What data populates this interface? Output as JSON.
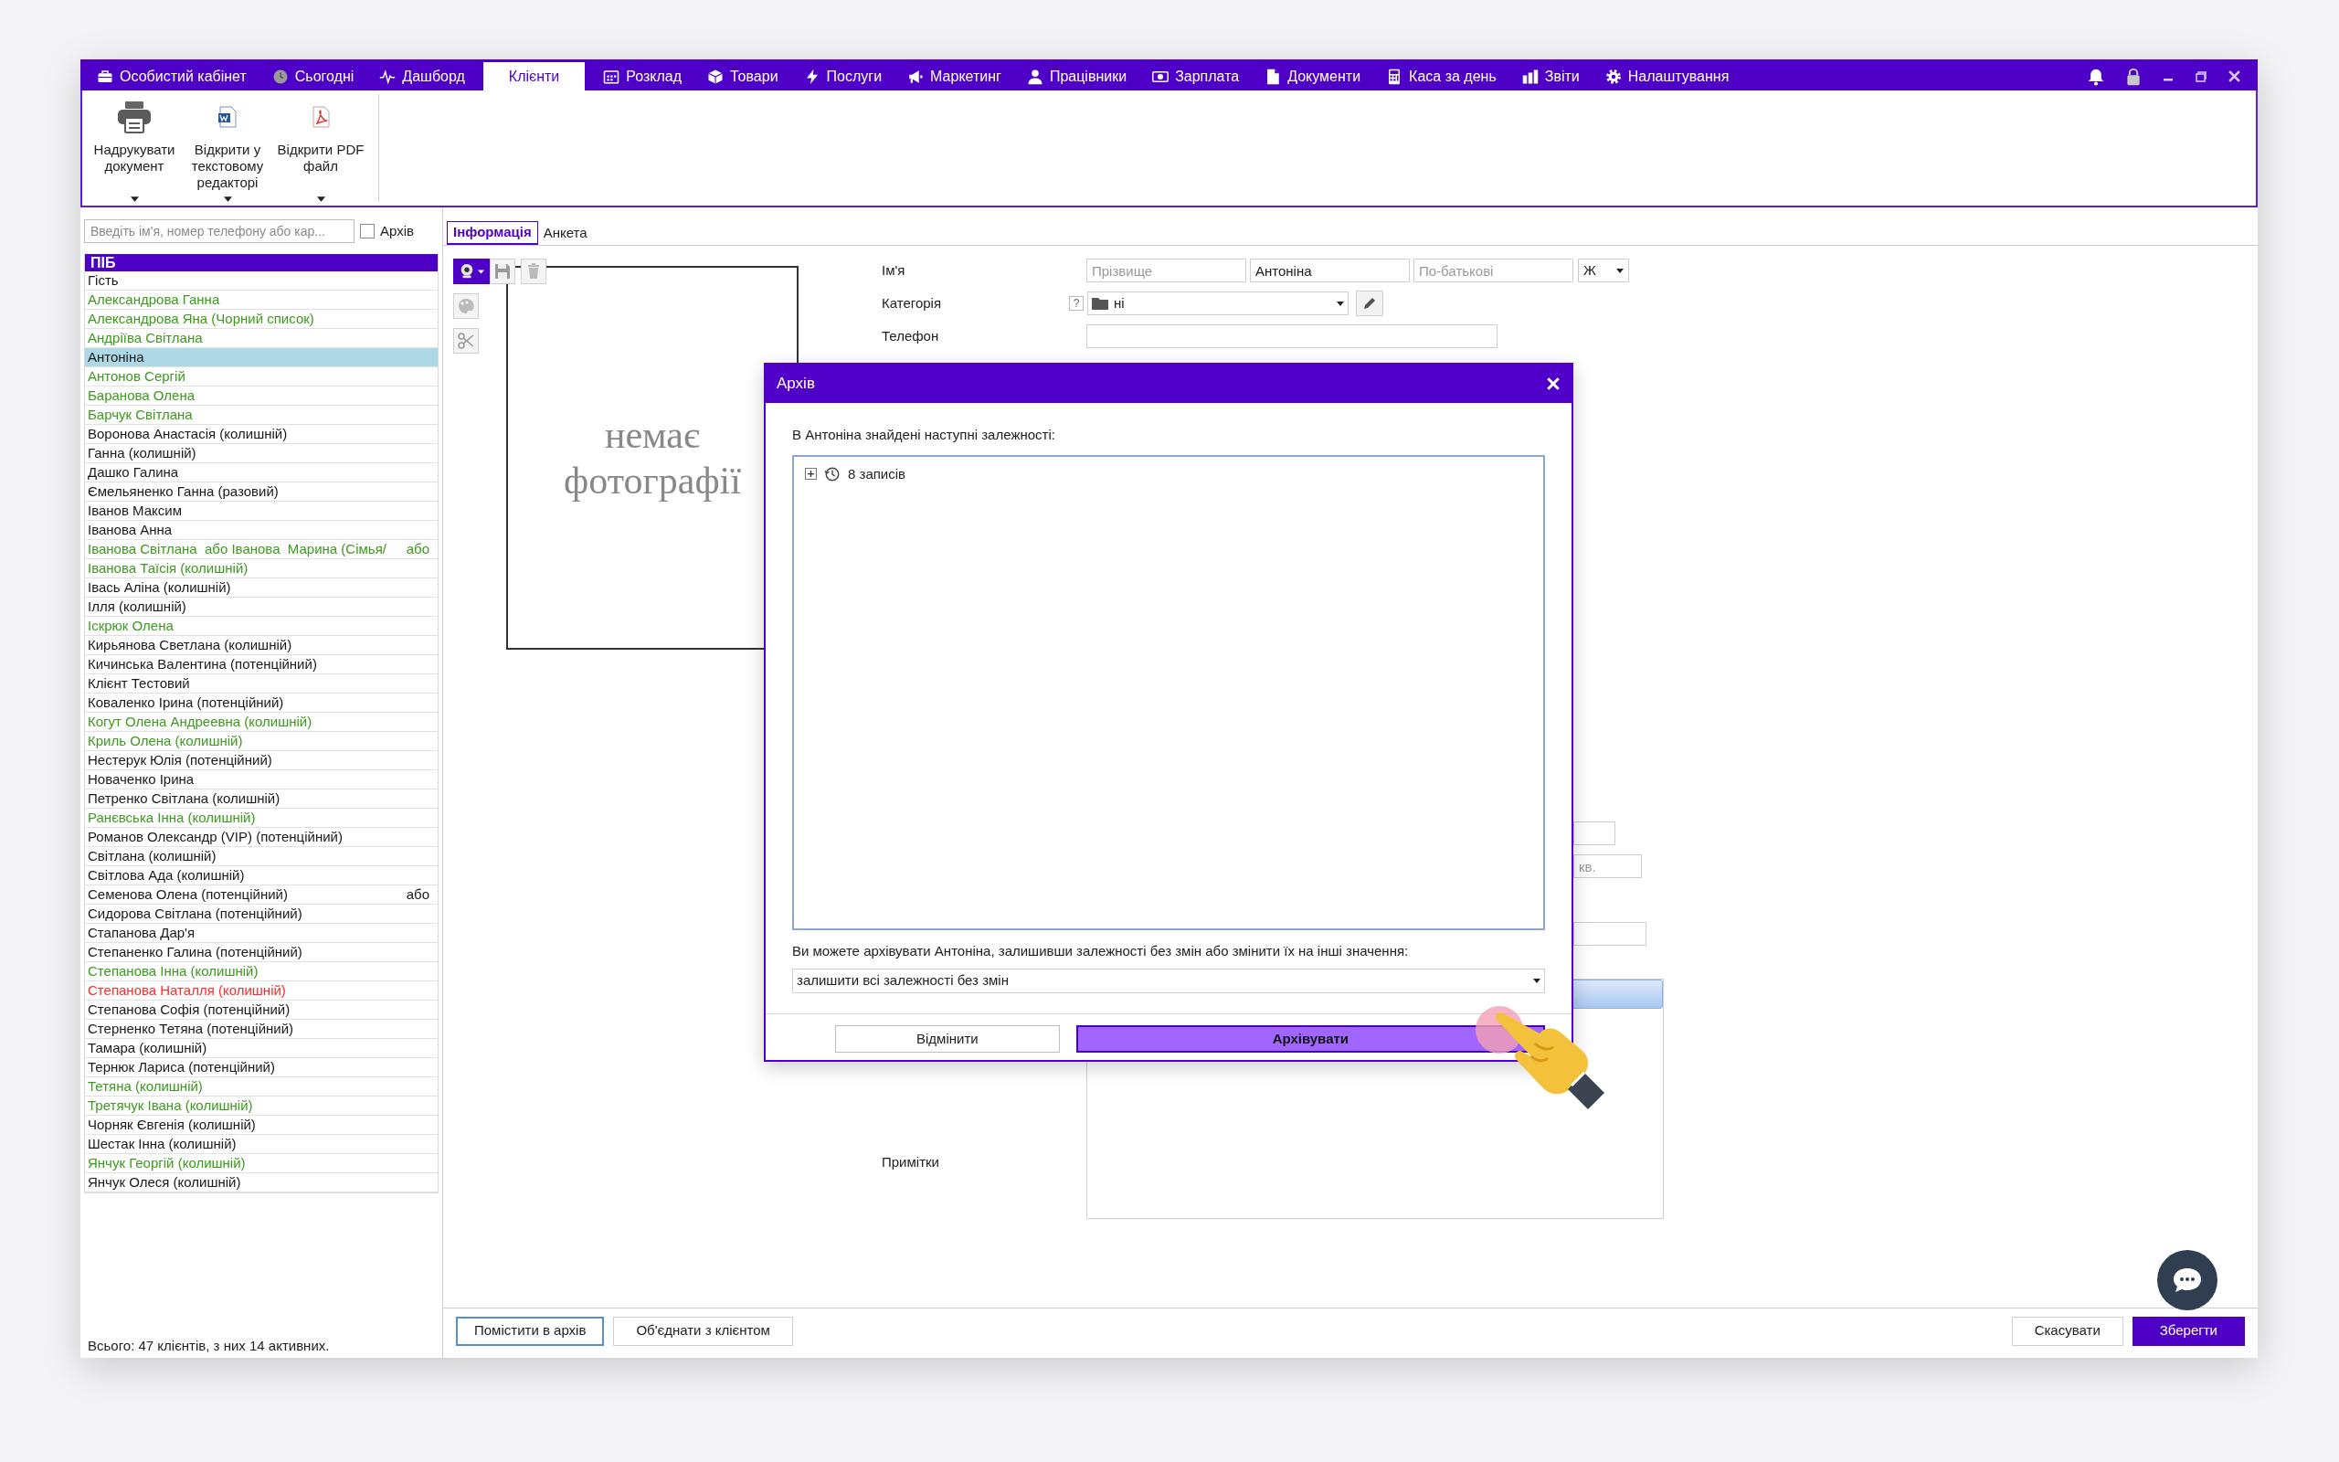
{
  "nav": {
    "items": [
      {
        "label": "Особистий кабінет",
        "selected": false
      },
      {
        "label": "Сьогодні",
        "selected": false
      },
      {
        "label": "Дашборд",
        "selected": false
      },
      {
        "label": "Клієнти",
        "selected": true
      },
      {
        "label": "Розклад",
        "selected": false
      },
      {
        "label": "Товари",
        "selected": false
      },
      {
        "label": "Послуги",
        "selected": false
      },
      {
        "label": "Маркетинг",
        "selected": false
      },
      {
        "label": "Працівники",
        "selected": false
      },
      {
        "label": "Зарплата",
        "selected": false
      },
      {
        "label": "Документи",
        "selected": false
      },
      {
        "label": "Каса за день",
        "selected": false
      },
      {
        "label": "Звіти",
        "selected": false
      },
      {
        "label": "Налаштування",
        "selected": false
      }
    ]
  },
  "ribbon": {
    "buttons": [
      {
        "label": "Надрукувати документ"
      },
      {
        "label": "Відкрити у текстовому редакторі"
      },
      {
        "label": "Відкрити PDF файл"
      }
    ]
  },
  "search": {
    "placeholder": "Введіть ім'я, номер телефону або кар...",
    "archive_label": "Архів",
    "archive_checked": false
  },
  "client_list": {
    "column": "ПІБ",
    "rows": [
      {
        "name": "Гість",
        "color": "#1a1a1a",
        "selected": false
      },
      {
        "name": "Александрова Ганна",
        "color": "#3c9a1e",
        "selected": false
      },
      {
        "name": "Александрова Яна (Чорний список)",
        "color": "#3c9a1e",
        "selected": false
      },
      {
        "name": "Андріїва Світлана",
        "color": "#3c9a1e",
        "selected": false
      },
      {
        "name": "Антоніна",
        "color": "#1a1a1a",
        "selected": true
      },
      {
        "name": "Антонов Сергій",
        "color": "#3c9a1e",
        "selected": false
      },
      {
        "name": "Баранова Олена",
        "color": "#3c9a1e",
        "selected": false
      },
      {
        "name": "Барчук Світлана",
        "color": "#3c9a1e",
        "selected": false
      },
      {
        "name": "Воронова Анастасія (колишній)",
        "color": "#1a1a1a",
        "selected": false
      },
      {
        "name": "Ганна (колишній)",
        "color": "#1a1a1a",
        "selected": false
      },
      {
        "name": "Дашко Галина",
        "color": "#1a1a1a",
        "selected": false
      },
      {
        "name": "Ємельяненко Ганна (разовий)",
        "color": "#1a1a1a",
        "selected": false
      },
      {
        "name": "Іванов Максим",
        "color": "#1a1a1a",
        "selected": false
      },
      {
        "name": "Іванова Анна",
        "color": "#1a1a1a",
        "selected": false
      },
      {
        "name": "Іванова Світлана  або Іванова  Марина (Сімья/",
        "extra": "або",
        "color": "#3c9a1e",
        "selected": false
      },
      {
        "name": "Іванова Таїсія (колишній)",
        "color": "#3c9a1e",
        "selected": false
      },
      {
        "name": "Івась Аліна (колишній)",
        "color": "#1a1a1a",
        "selected": false
      },
      {
        "name": "Ілля (колишній)",
        "color": "#1a1a1a",
        "selected": false
      },
      {
        "name": "Іскрюк Олена",
        "color": "#3c9a1e",
        "selected": false
      },
      {
        "name": "Кирьянова Светлана (колишній)",
        "color": "#1a1a1a",
        "selected": false
      },
      {
        "name": "Кичинська Валентина (потенційний)",
        "color": "#1a1a1a",
        "selected": false
      },
      {
        "name": "Клієнт Тестовий",
        "color": "#1a1a1a",
        "selected": false
      },
      {
        "name": "Коваленко Ірина (потенційний)",
        "color": "#1a1a1a",
        "selected": false
      },
      {
        "name": "Когут Олена Андреевна (колишній)",
        "color": "#3c9a1e",
        "selected": false
      },
      {
        "name": "Криль Олена (колишній)",
        "color": "#3c9a1e",
        "selected": false
      },
      {
        "name": "Нестерук Юлія (потенційний)",
        "color": "#1a1a1a",
        "selected": false
      },
      {
        "name": "Новаченко Ірина",
        "color": "#1a1a1a",
        "selected": false
      },
      {
        "name": "Петренко Світлана (колишній)",
        "color": "#1a1a1a",
        "selected": false
      },
      {
        "name": "Ранєвська Інна (колишній)",
        "color": "#3c9a1e",
        "selected": false
      },
      {
        "name": "Романов Олександр (VIP) (потенційний)",
        "color": "#1a1a1a",
        "selected": false
      },
      {
        "name": "Світлана (колишній)",
        "color": "#1a1a1a",
        "selected": false
      },
      {
        "name": "Світлова Ада (колишній)",
        "color": "#1a1a1a",
        "selected": false
      },
      {
        "name": "Семенова Олена (потенційний)",
        "extra": "або",
        "color": "#1a1a1a",
        "selected": false
      },
      {
        "name": "Сидорова Світлана (потенційний)",
        "color": "#1a1a1a",
        "selected": false
      },
      {
        "name": "Стапанова Дар'я",
        "color": "#1a1a1a",
        "selected": false
      },
      {
        "name": "Степаненко Галина (потенційний)",
        "color": "#1a1a1a",
        "selected": false
      },
      {
        "name": "Степанова Інна (колишній)",
        "color": "#3c9a1e",
        "selected": false
      },
      {
        "name": "Степанова Наталля (колишній)",
        "color": "#ff2b2b",
        "selected": false
      },
      {
        "name": "Степанова Софія (потенційний)",
        "color": "#1a1a1a",
        "selected": false
      },
      {
        "name": "Стерненко Тетяна (потенційний)",
        "color": "#1a1a1a",
        "selected": false
      },
      {
        "name": "Тамара (колишній)",
        "color": "#1a1a1a",
        "selected": false
      },
      {
        "name": "Тернюк Лариса (потенційний)",
        "color": "#1a1a1a",
        "selected": false
      },
      {
        "name": "Тетяна (колишній)",
        "color": "#3c9a1e",
        "selected": false
      },
      {
        "name": "Третячук Івана (колишній)",
        "color": "#3c9a1e",
        "selected": false
      },
      {
        "name": "Чорняк Євгенія (колишній)",
        "color": "#1a1a1a",
        "selected": false
      },
      {
        "name": "Шестак Інна (колишній)",
        "color": "#1a1a1a",
        "selected": false
      },
      {
        "name": "Янчук Георгій (колишній)",
        "color": "#3c9a1e",
        "selected": false
      },
      {
        "name": "Янчук Олеся (колишній)",
        "color": "#1a1a1a",
        "selected": false
      }
    ]
  },
  "status": "Всього: 47 клієнтів, з них 14 активних.",
  "tabs": [
    {
      "label": "Інформація",
      "selected": true
    },
    {
      "label": "Анкета",
      "selected": false
    }
  ],
  "photo": {
    "placeholder_text": "немає фотографії"
  },
  "form": {
    "name_label": "Ім'я",
    "surname_placeholder": "Прізвище",
    "first_name": "Антоніна",
    "patronymic_placeholder": "По-батькові",
    "gender": "Ж",
    "category_label": "Категорія",
    "category_help": "?",
    "category": "ні",
    "phone_label": "Телефон",
    "apartment_placeholder": "кв.",
    "notes_label": "Примітки"
  },
  "dialog": {
    "title": "Архів",
    "intro": "В Антоніна знайдені наступні залежності:",
    "tree": [
      {
        "label": "8 записів",
        "expanded": false
      }
    ],
    "hint": "Ви можете архівувати Антоніна, залишивши залежності без змін або змінити їх на інші значення:",
    "option": "залишити всі залежності без змін",
    "buttons": [
      {
        "label": "Відмінити",
        "kind": "secondary"
      },
      {
        "label": "Архівувати",
        "kind": "primary"
      }
    ]
  },
  "bottom_buttons": [
    {
      "label": "Помістити в архів",
      "kind": "focused"
    },
    {
      "label": "Об'єднати з клієнтом",
      "kind": "plain"
    },
    {
      "label": "Скасувати",
      "kind": "plain"
    },
    {
      "label": "Зберегти",
      "kind": "primary"
    }
  ]
}
